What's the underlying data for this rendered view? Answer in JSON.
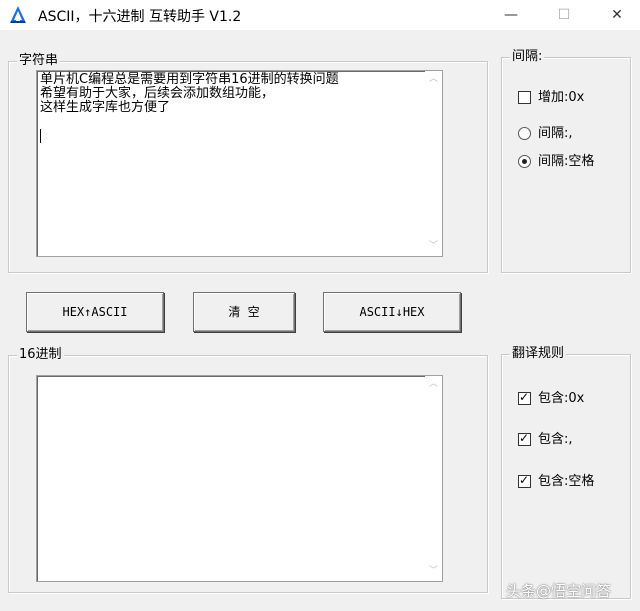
{
  "window": {
    "title": "ASCII，十六进制 互转助手 V1.2",
    "minimize": "—",
    "maximize": "☐",
    "close": "✕"
  },
  "string_group": {
    "legend": "字符串",
    "text": "单片机C编程总是需要用到字符串16进制的转换问题\n希望有助于大家，后续会添加数组功能，\n这样生成字库也方便了"
  },
  "buttons": {
    "hex_to_ascii": "HEX↑ASCII",
    "clear": "清 空",
    "ascii_to_hex": "ASCII↓HEX"
  },
  "hex_group": {
    "legend": "16进制",
    "text": ""
  },
  "spacing_group": {
    "legend": "间隔:",
    "add_0x": {
      "label": "增加:0x",
      "checked": false
    },
    "comma": {
      "label": "间隔:,",
      "selected": false
    },
    "space": {
      "label": "间隔:空格",
      "selected": true
    }
  },
  "rules_group": {
    "legend": "翻译规则",
    "include_0x": {
      "label": "包含:0x",
      "checked": true
    },
    "include_comma": {
      "label": "包含:,",
      "checked": true
    },
    "include_space": {
      "label": "包含:空格",
      "checked": true
    }
  },
  "watermark": "头条@悟空问答",
  "icons": {
    "app": "app-logo-icon",
    "tick": "✓",
    "scroll_up": "︿",
    "scroll_down": "﹀"
  }
}
